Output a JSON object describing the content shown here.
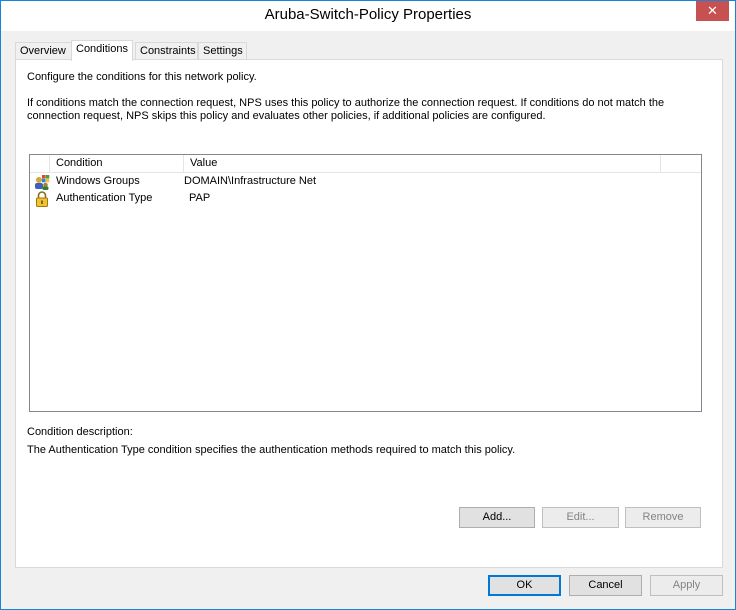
{
  "window": {
    "title": "Aruba-Switch-Policy Properties",
    "close_symbol": "✕"
  },
  "tabs": [
    {
      "label": "Overview"
    },
    {
      "label": "Conditions"
    },
    {
      "label": "Constraints"
    },
    {
      "label": "Settings"
    }
  ],
  "conditions": {
    "intro": "Configure the conditions for this network policy.",
    "explanation_line1": "If conditions match the connection request, NPS uses this policy to authorize the connection request. If conditions do not match the",
    "explanation_line2": "connection request, NPS skips this policy and evaluates other policies, if additional policies are configured.",
    "list": {
      "columns": {
        "condition": "Condition",
        "value": "Value"
      },
      "rows": [
        {
          "icon": "windows-groups-icon",
          "condition": "Windows Groups",
          "value": "DOMAIN\\Infrastructure Net"
        },
        {
          "icon": "lock-icon",
          "condition": "Authentication Type",
          "value": "PAP"
        }
      ]
    },
    "description_label": "Condition description:",
    "description_text": "The Authentication Type condition specifies the authentication methods required to match this policy.",
    "buttons": {
      "add": "Add...",
      "edit": "Edit...",
      "remove": "Remove"
    }
  },
  "footer": {
    "ok": "OK",
    "cancel": "Cancel",
    "apply": "Apply"
  },
  "colors": {
    "accent": "#0078d7",
    "close": "#c75050",
    "border": "#1883d7"
  }
}
